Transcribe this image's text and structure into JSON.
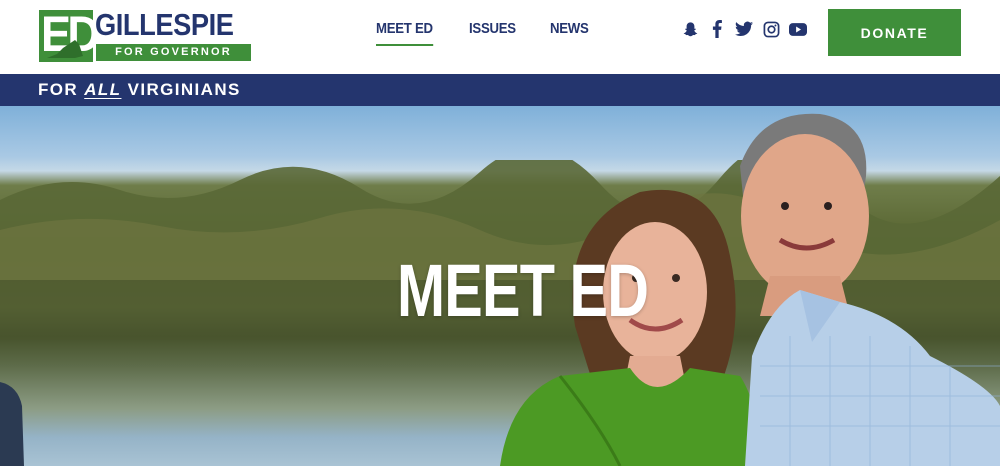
{
  "brand": {
    "initials": "ED",
    "name": "GILLESPIE",
    "subtitle": "FOR GOVERNOR"
  },
  "nav": {
    "items": [
      {
        "label": "MEET ED",
        "active": true
      },
      {
        "label": "ISSUES",
        "active": false
      },
      {
        "label": "NEWS",
        "active": false
      }
    ]
  },
  "social": [
    "snapchat-icon",
    "facebook-icon",
    "twitter-icon",
    "instagram-icon",
    "youtube-icon"
  ],
  "donate_label": "DONATE",
  "banner": {
    "prefix": "FOR",
    "emphasis": "ALL",
    "suffix": "VIRGINIANS"
  },
  "hero": {
    "title": "MEET ED"
  },
  "colors": {
    "green": "#3f8f3a",
    "navy": "#24356e",
    "white": "#ffffff"
  }
}
